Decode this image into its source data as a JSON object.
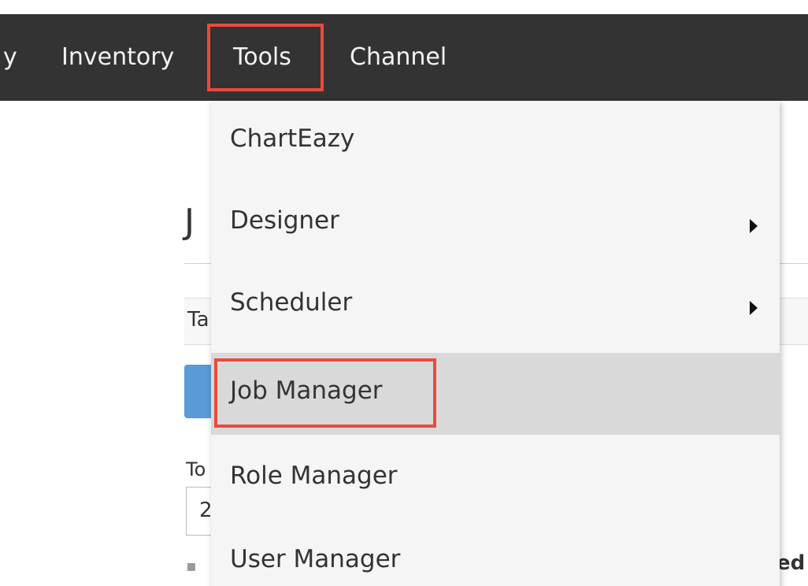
{
  "navbar": {
    "items": [
      {
        "label": "y"
      },
      {
        "label": "Inventory"
      },
      {
        "label": "Tools"
      },
      {
        "label": "Channel"
      }
    ]
  },
  "background": {
    "heading_fragment": "J",
    "panel_fragment": "Ta",
    "label_fragment": "To",
    "input_fragment": "2",
    "column_fragment": "ed"
  },
  "dropdown": {
    "items": [
      {
        "label": "ChartEazy",
        "submenu": false
      },
      {
        "label": "Designer",
        "submenu": true
      },
      {
        "label": "Scheduler",
        "submenu": true
      },
      {
        "label": "Job Manager",
        "submenu": false,
        "highlighted": true
      },
      {
        "label": "Role Manager",
        "submenu": false
      },
      {
        "label": "User Manager",
        "submenu": false
      }
    ]
  },
  "colors": {
    "navbar_bg": "#333333",
    "highlight_border": "#e74c3c",
    "dropdown_bg": "#f5f5f5",
    "active_item_bg": "#d9d9d9",
    "button_blue": "#5b9bd5"
  }
}
